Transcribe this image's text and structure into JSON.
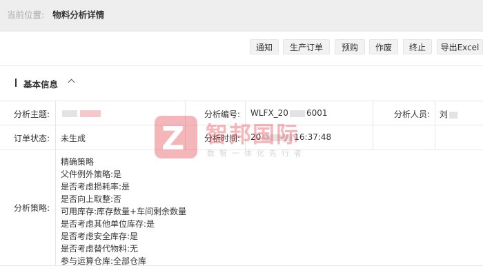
{
  "breadcrumb": {
    "label": "当前位置:",
    "current": "物料分析详情"
  },
  "toolbar": {
    "buttons": [
      "通知",
      "生产订单",
      "预购",
      "作废",
      "终止",
      "导出Excel"
    ]
  },
  "section": {
    "title": "基本信息"
  },
  "fields": {
    "subject_label": "分析主题:",
    "number_label": "分析编号:",
    "number_value_prefix": "WLFX_20",
    "number_value_suffix": "6001",
    "analyst_label": "分析人员:",
    "analyst_value": "刘",
    "order_status_label": "订单状态:",
    "order_status_value": "未生成",
    "time_label": "分析时间:",
    "time_value_prefix": "20",
    "time_value_suffix": "16:37:48",
    "strategy_label": "分析策略:"
  },
  "strategy": [
    "精确策略",
    "父件例外策略:是",
    "是否考虑损耗率:是",
    "是否向上取整:否",
    "可用库存:库存数量+车间剩余数量",
    "是否考虑其他单位库存:是",
    "是否考虑安全库存:是",
    "是否考虑替代物料:无",
    "参与运算仓库:全部仓库"
  ],
  "watermark": {
    "title": "智邦国际",
    "subtitle": "数智一体化先行者",
    "logo_letter": "Z"
  },
  "colors": {
    "topbar": "#eeeeee",
    "brand_red": "#e5313c"
  }
}
